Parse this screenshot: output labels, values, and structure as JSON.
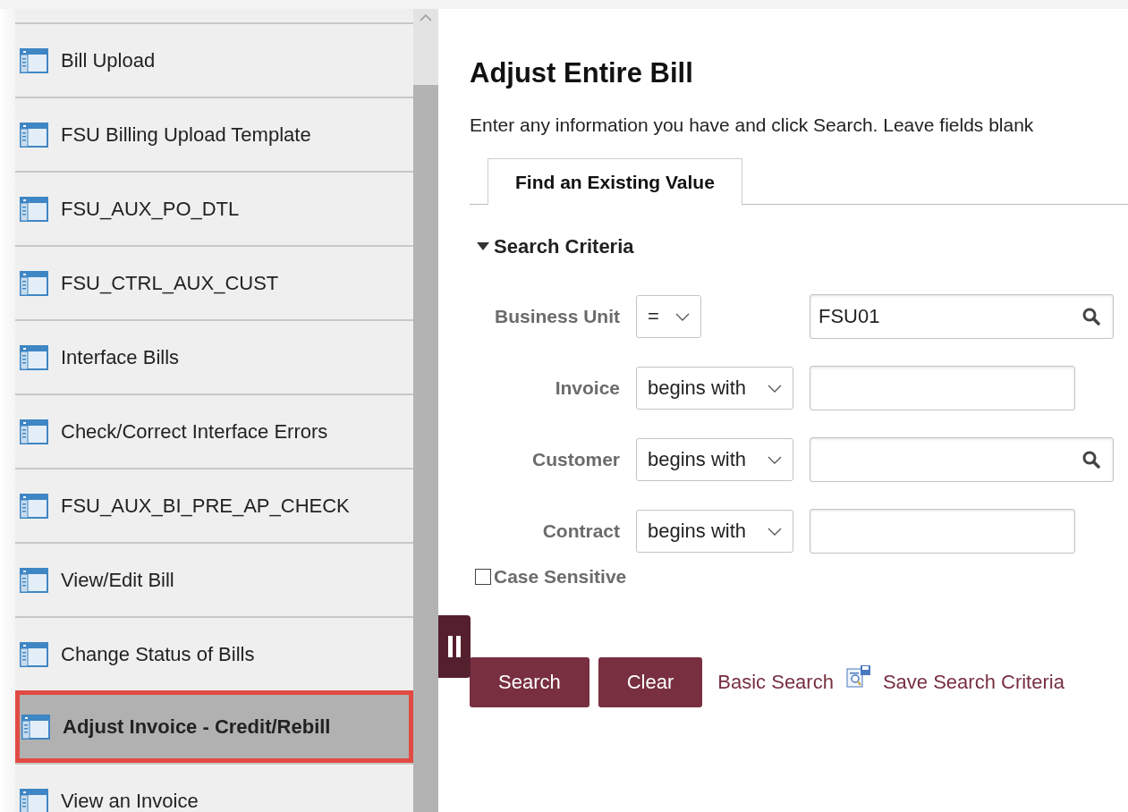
{
  "sidebar": {
    "items": [
      {
        "label": "Bill Upload",
        "selected": false
      },
      {
        "label": "FSU Billing Upload Template",
        "selected": false
      },
      {
        "label": "FSU_AUX_PO_DTL",
        "selected": false
      },
      {
        "label": "FSU_CTRL_AUX_CUST",
        "selected": false
      },
      {
        "label": "Interface Bills",
        "selected": false
      },
      {
        "label": "Check/Correct Interface Errors",
        "selected": false
      },
      {
        "label": "FSU_AUX_BI_PRE_AP_CHECK",
        "selected": false
      },
      {
        "label": "View/Edit Bill",
        "selected": false
      },
      {
        "label": "Change Status of Bills",
        "selected": false
      },
      {
        "label": "Adjust Invoice - Credit/Rebill",
        "selected": true
      },
      {
        "label": "View an Invoice",
        "selected": false
      }
    ]
  },
  "page": {
    "title": "Adjust Entire Bill",
    "instructions": "Enter any information you have and click Search. Leave fields blank",
    "tabs": [
      {
        "label": "Find an Existing Value",
        "selected": true
      }
    ],
    "section": {
      "title": "Search Criteria",
      "expanded": true
    },
    "criteria": [
      {
        "label": "Business Unit",
        "operator": "=",
        "value": "FSU01",
        "kind": "lookup"
      },
      {
        "label": "Invoice",
        "operator": "begins with",
        "kind": "text"
      },
      {
        "label": "Customer",
        "operator": "begins with",
        "kind": "lookup"
      },
      {
        "label": "Contract",
        "operator": "begins with",
        "kind": "text"
      }
    ],
    "case_sensitive": {
      "label": "Case Sensitive",
      "checked": false
    },
    "buttons": [
      "Search",
      "Clear"
    ],
    "links": [
      {
        "label": "Basic Search",
        "kind": "plain"
      },
      {
        "label": "Save Search Criteria",
        "kind": "icon"
      }
    ]
  }
}
